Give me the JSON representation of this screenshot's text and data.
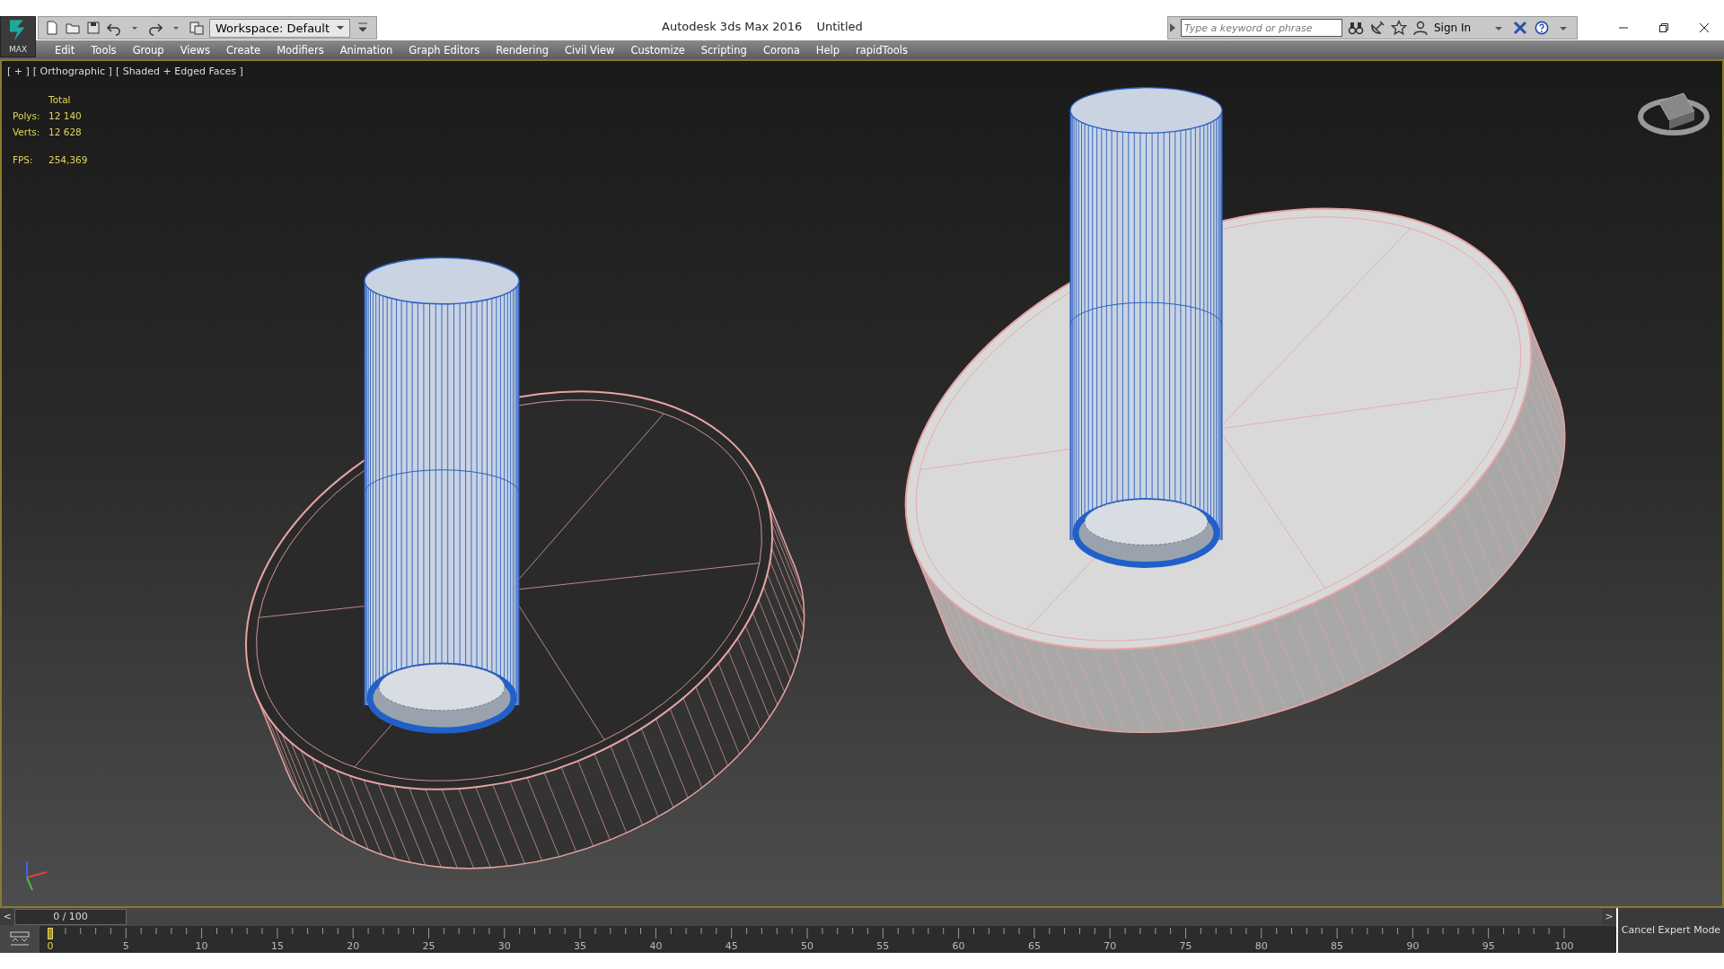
{
  "app": {
    "logo": "MAX",
    "title": "Autodesk 3ds Max 2016",
    "document": "Untitled",
    "workspace": "Workspace: Default",
    "search": {
      "placeholder": "Type a keyword or phrase"
    },
    "sign_in": "Sign In"
  },
  "menu": [
    "Edit",
    "Tools",
    "Group",
    "Views",
    "Create",
    "Modifiers",
    "Animation",
    "Graph Editors",
    "Rendering",
    "Civil View",
    "Customize",
    "Scripting",
    "Corona",
    "Help",
    "rapidTools"
  ],
  "viewport": {
    "labels": [
      "[ + ]",
      "[ Orthographic ]",
      "[ Shaded + Edged Faces ]"
    ],
    "stats": {
      "heading": "Total",
      "rows": [
        {
          "label": "Polys:",
          "value": "12 140"
        },
        {
          "label": "Verts:",
          "value": "12 628"
        }
      ],
      "fps": {
        "label": "FPS:",
        "value": "254,369"
      }
    }
  },
  "time_slider": {
    "prev": "<",
    "reading": "0 / 100",
    "next": ">",
    "level": 0
  },
  "timeline": {
    "frames": [
      {
        "label": "0",
        "selected": true
      },
      {
        "label": "5",
        "selected": false
      },
      {
        "label": "10",
        "selected": false
      },
      {
        "label": "15",
        "selected": false
      },
      {
        "label": "20",
        "selected": false
      },
      {
        "label": "25",
        "selected": false
      },
      {
        "label": "30",
        "selected": false
      },
      {
        "label": "35",
        "selected": false
      },
      {
        "label": "40",
        "selected": false
      },
      {
        "label": "45",
        "selected": false
      },
      {
        "label": "50",
        "selected": false
      },
      {
        "label": "55",
        "selected": false
      },
      {
        "label": "60",
        "selected": false
      },
      {
        "label": "65",
        "selected": false
      },
      {
        "label": "70",
        "selected": false
      },
      {
        "label": "75",
        "selected": false
      },
      {
        "label": "80",
        "selected": false
      },
      {
        "label": "85",
        "selected": false
      },
      {
        "label": "90",
        "selected": false
      },
      {
        "label": "95",
        "selected": false
      },
      {
        "label": "100",
        "selected": false
      }
    ]
  },
  "expert_button": "Cancel Expert Mode"
}
